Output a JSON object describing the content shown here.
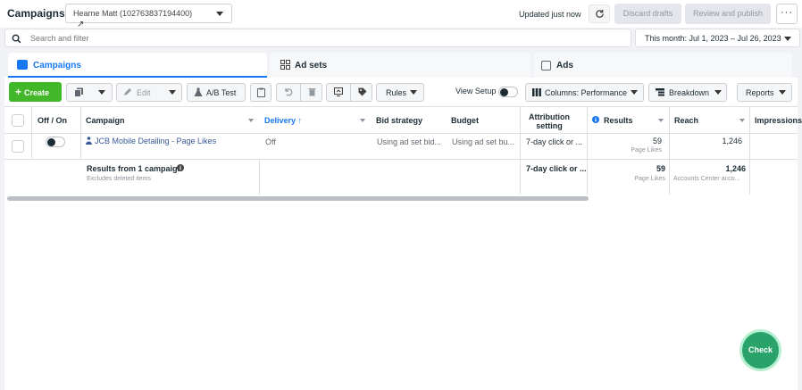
{
  "header": {
    "title": "Campaigns",
    "account": "Hearne Matt (102763837194400)",
    "updated": "Updated just now",
    "discard": "Discard drafts",
    "review": "Review and publish",
    "more": "···"
  },
  "search": {
    "placeholder": "Search and filter"
  },
  "date_range": "This month: Jul 1, 2023 – Jul 26, 2023",
  "tabs": [
    {
      "label": "Campaigns",
      "icon": "folder-icon"
    },
    {
      "label": "Ad sets",
      "icon": "grid-icon"
    },
    {
      "label": "Ads",
      "icon": "ad-icon"
    }
  ],
  "toolbar": {
    "create": "Create",
    "edit": "Edit",
    "ab_test": "A/B Test",
    "rules": "Rules",
    "view_setup": "View Setup",
    "columns": "Columns: Performance",
    "breakdown": "Breakdown",
    "reports": "Reports"
  },
  "table": {
    "headers": {
      "off_on": "Off / On",
      "campaign": "Campaign",
      "delivery": "Delivery ↑",
      "bid": "Bid strategy",
      "budget": "Budget",
      "attribution": "Attribution setting",
      "results": "Results",
      "reach": "Reach",
      "impressions": "Impressions"
    },
    "row": {
      "campaign": "JCB Mobile Detailing - Page Likes",
      "delivery": "Off",
      "bid": "Using ad set bid...",
      "budget": "Using ad set bu...",
      "attribution": "7-day click or ...",
      "results": "59",
      "results_sub": "Page Likes",
      "reach": "1,246"
    },
    "summary": {
      "label": "Results from 1 campaign",
      "sub": "Excludes deleted items",
      "attribution": "7-day click or ...",
      "results": "59",
      "results_sub": "Page Likes",
      "reach": "1,246",
      "reach_sub": "Accounts Center acco..."
    }
  },
  "fab": "Check",
  "colors": {
    "accent": "#1877f2",
    "create": "#42b72a",
    "fab": "#29a36a"
  }
}
